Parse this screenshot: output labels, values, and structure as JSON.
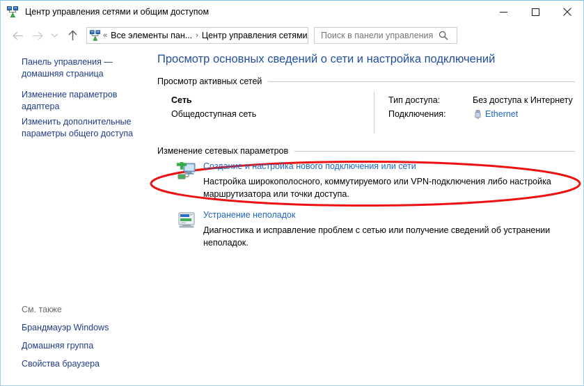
{
  "window": {
    "title": "Центр управления сетями и общим доступом",
    "icon": "network-sharing-center-icon",
    "controls": {
      "minimize": "minimize-button",
      "maximize": "maximize-button",
      "close": "close-button"
    }
  },
  "navbar": {
    "back": "back-button",
    "forward": "forward-button",
    "history": "recent-locations-button",
    "up": "up-button",
    "address": {
      "icon": "network-sharing-center-icon",
      "crumbs": [
        {
          "label": "Все элементы пан...",
          "sep": "»"
        },
        {
          "label": "Центр управления сетями и общим доступом",
          "sep": "›"
        }
      ],
      "leading_sep": "«",
      "separator": "›",
      "dropdown": "previous-locations-dropdown",
      "refresh": "refresh-button"
    },
    "search": {
      "placeholder": "Поиск в панели управления",
      "value": "",
      "icon": "search-icon"
    }
  },
  "sidebar": {
    "links": [
      "Панель управления — домашняя страница",
      "Изменение параметров адаптера",
      "Изменить дополнительные параметры общего доступа"
    ],
    "see_also": {
      "title": "См. также",
      "links": [
        "Брандмауэр Windows",
        "Домашняя группа",
        "Свойства браузера"
      ]
    }
  },
  "content": {
    "heading": "Просмотр основных сведений о сети и настройка подключений",
    "sections": [
      {
        "title": "Просмотр активных сетей"
      },
      {
        "title": "Изменение сетевых параметров"
      }
    ],
    "active_network": {
      "name": "Сеть",
      "type": "Общедоступная сеть",
      "access_label": "Тип доступа:",
      "access_value": "Без доступа к Интернету",
      "connections_label": "Подключения:",
      "connections_value": "Ethernet",
      "connections_icon": "ethernet-adapter-icon"
    },
    "tasks": [
      {
        "icon": "new-connection-icon",
        "link": "Создание и настройка нового подключения или сети",
        "description": "Настройка широкополосного, коммутируемого или VPN-подключения либо настройка маршрутизатора или точки доступа."
      },
      {
        "icon": "troubleshoot-icon",
        "link": "Устранение неполадок",
        "description": "Диагностика и исправление проблем с сетью или получение сведений об устранении неполадок."
      }
    ],
    "annotation": {
      "shape": "ellipse",
      "target": "Создание и настройка нового подключения или сети",
      "color": "#ee1111"
    }
  },
  "colors": {
    "window_border": "#9fd0ec",
    "heading": "#23509e",
    "link": "#1f66c1",
    "sidebar_link": "#1f3c88",
    "muted_text": "#6d6d6d",
    "rule": "#c8c8c8",
    "annotation": "#ee1111"
  }
}
